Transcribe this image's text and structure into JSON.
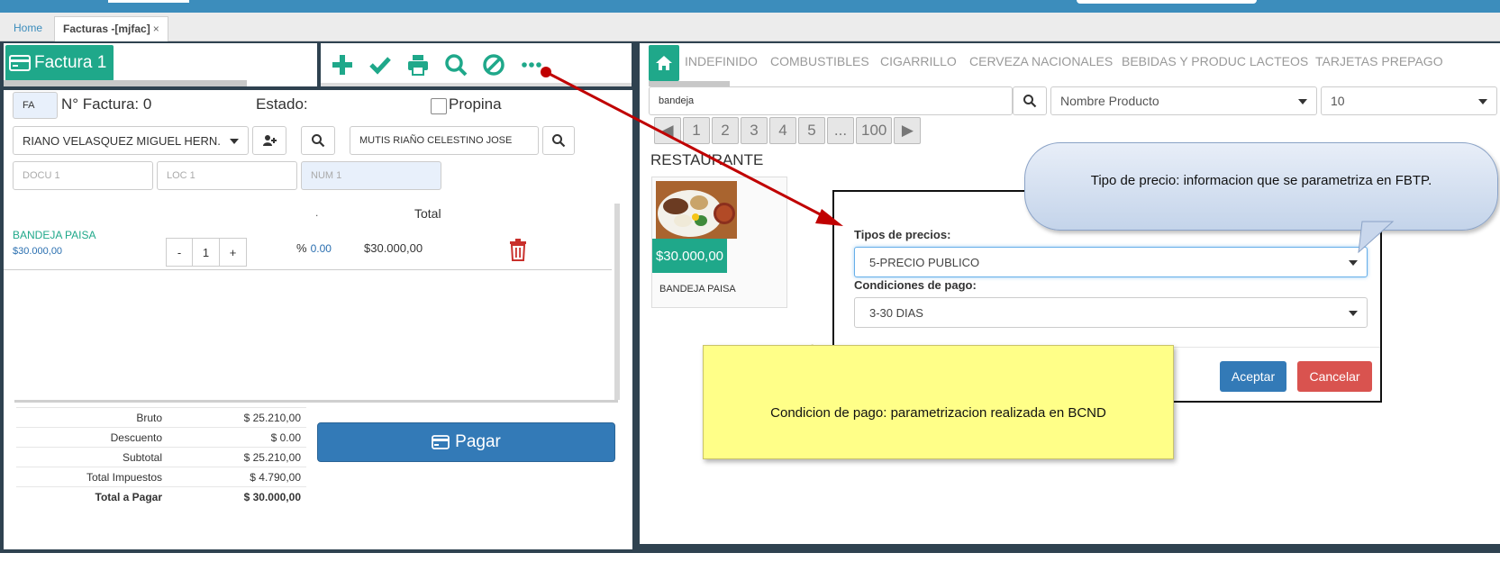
{
  "tabs": {
    "home": "Home",
    "facturas": "Facturas -[mjfac]",
    "close": "×"
  },
  "invoice": {
    "title": "Factura 1",
    "type_code": "FA",
    "number_label": "N° Factura: 0",
    "status_label": "Estado:",
    "tip_label": "Propina",
    "client": "RIANO VELASQUEZ MIGUEL HERN.",
    "seller": "MUTIS RIAÑO CELESTINO JOSE",
    "doc_placeholder": "DOCU 1",
    "loc_placeholder": "LOC 1",
    "num_placeholder": "NUM 1"
  },
  "items": {
    "col_dot": ".",
    "col_total": "Total",
    "rows": [
      {
        "name": "BANDEJA PAISA",
        "price": "$30.000,00",
        "minus": "-",
        "qty": "1",
        "plus": "+",
        "pct_label": "%",
        "pct_value": "0.00",
        "total": "$30.000,00"
      }
    ]
  },
  "totals": [
    {
      "label": "Bruto",
      "value": "$ 25.210,00"
    },
    {
      "label": "Descuento",
      "value": "$ 0.00"
    },
    {
      "label": "Subtotal",
      "value": "$ 25.210,00"
    },
    {
      "label": "Total Impuestos",
      "value": "$ 4.790,00"
    },
    {
      "label": "Total a Pagar",
      "value": "$ 30.000,00"
    }
  ],
  "pay_label": "Pagar",
  "categories": [
    "INDEFINIDO",
    "COMBUSTIBLES",
    "CIGARRILLO",
    "CERVEZA NACIONALES",
    "BEBIDAS Y PRODUC LACTEOS",
    "TARJETAS PREPAGO"
  ],
  "search": {
    "value": "bandeja",
    "filter": "Nombre Producto",
    "page_size": "10"
  },
  "pager": [
    "◀",
    "1",
    "2",
    "3",
    "4",
    "5",
    "...",
    "100",
    "▶"
  ],
  "section_title": "RESTAURANTE",
  "product_card": {
    "price": "$30.000,00",
    "name": "BANDEJA PAISA"
  },
  "dialog": {
    "price_type_label": "Tipos de precios:",
    "price_type_value": "5-PRECIO PUBLICO",
    "payment_label": "Condiciones de pago:",
    "payment_value": "3-30 DIAS",
    "ok": "Aceptar",
    "cancel": "Cancelar"
  },
  "callouts": {
    "bubble": "Tipo de precio: informacion que se parametriza en FBTP.",
    "note": "Condicion de pago: parametrizacion realizada en BCND"
  },
  "colors": {
    "brand_green": "#1fa88a",
    "primary_blue": "#337ab7",
    "danger_red": "#d9534f",
    "topbar": "#3c8dbc",
    "arrow": "#c00000"
  }
}
